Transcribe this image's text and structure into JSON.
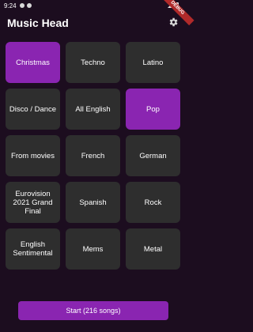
{
  "status_bar": {
    "time": "9:24",
    "debug_label": "DEBUG"
  },
  "header": {
    "title": "Music Head",
    "settings_icon": "gear-icon"
  },
  "colors": {
    "background": "#1c0d1f",
    "tile": "#2e2e2e",
    "selected": "#8a25b1"
  },
  "genres": [
    {
      "label": "Christmas",
      "selected": true
    },
    {
      "label": "Techno",
      "selected": false
    },
    {
      "label": "Latino",
      "selected": false
    },
    {
      "label": "Disco / Dance",
      "selected": false
    },
    {
      "label": "All English",
      "selected": false
    },
    {
      "label": "Pop",
      "selected": true
    },
    {
      "label": "From movies",
      "selected": false
    },
    {
      "label": "French",
      "selected": false
    },
    {
      "label": "German",
      "selected": false
    },
    {
      "label": "Eurovision 2021 Grand Final",
      "selected": false
    },
    {
      "label": "Spanish",
      "selected": false
    },
    {
      "label": "Rock",
      "selected": false
    },
    {
      "label": "English Sentimental",
      "selected": false
    },
    {
      "label": "Mems",
      "selected": false
    },
    {
      "label": "Metal",
      "selected": false
    }
  ],
  "start_button": {
    "label": "Start (216 songs)"
  }
}
